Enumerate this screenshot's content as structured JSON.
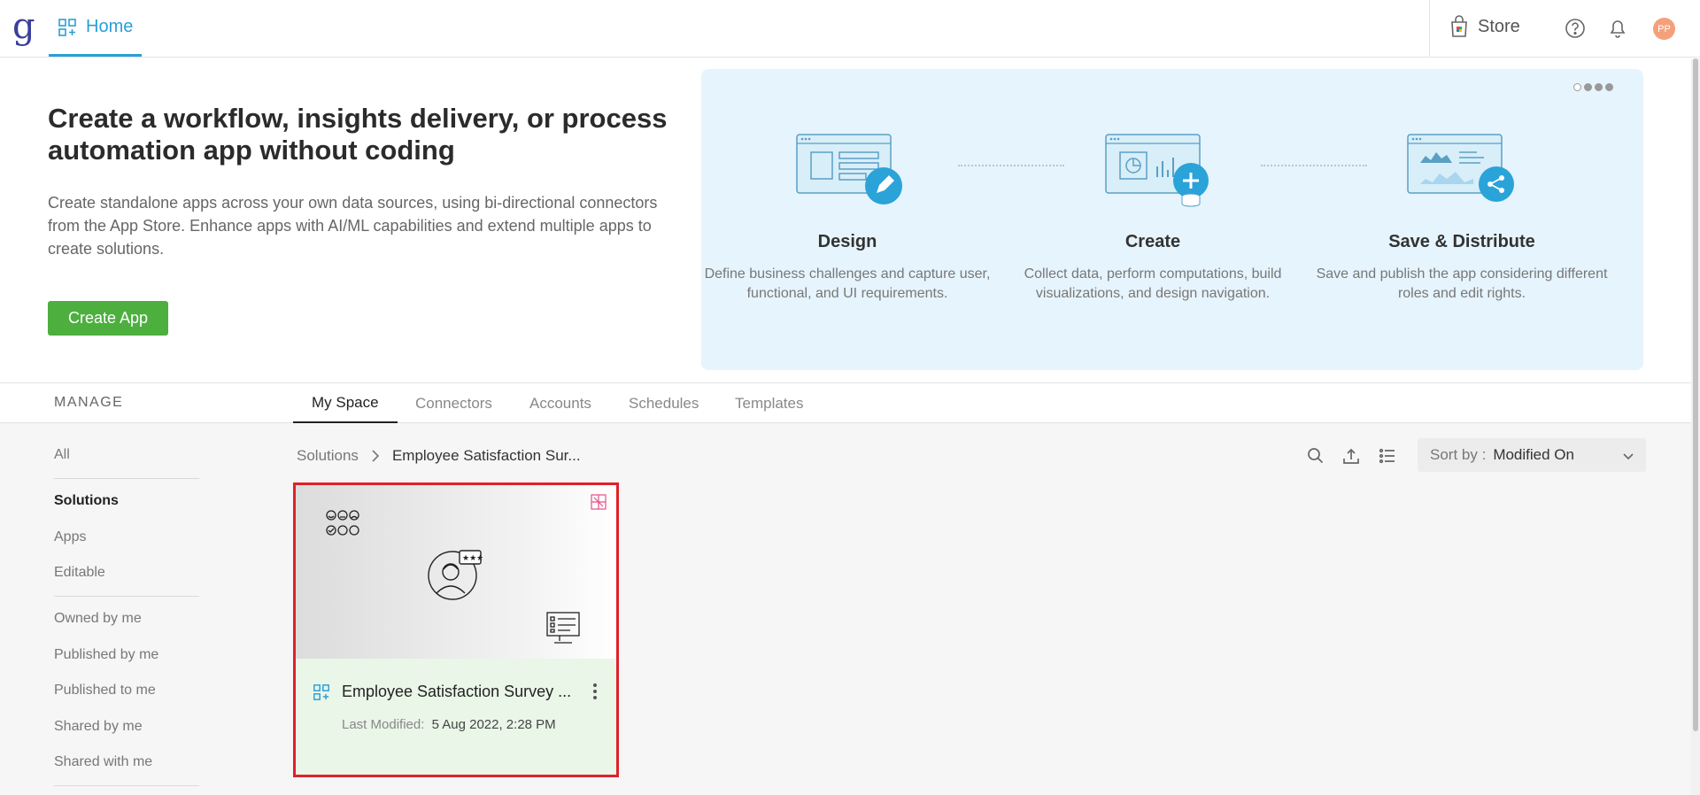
{
  "topbar": {
    "logo": "g",
    "home_label": "Home",
    "store_label": "Store",
    "avatar_initials": "PP"
  },
  "hero": {
    "title": "Create a workflow, insights delivery, or process automation app without coding",
    "description": "Create standalone apps across your own data sources, using bi-directional connectors from the App Store. Enhance apps with AI/ML capabilities and extend multiple apps to create solutions.",
    "create_button": "Create App"
  },
  "promo": {
    "steps": [
      {
        "title": "Design",
        "description": "Define business challenges and capture user, functional, and UI requirements."
      },
      {
        "title": "Create",
        "description": "Collect data, perform computations, build visualizations, and design navigation."
      },
      {
        "title": "Save & Distribute",
        "description": "Save and publish the app considering different roles and edit rights."
      }
    ],
    "accent_color": "#2aa3d9"
  },
  "manage": {
    "label": "MANAGE",
    "tabs": [
      {
        "label": "My Space"
      },
      {
        "label": "Connectors"
      },
      {
        "label": "Accounts"
      },
      {
        "label": "Schedules"
      },
      {
        "label": "Templates"
      }
    ]
  },
  "sidebar": {
    "items": [
      {
        "label": "All"
      },
      {
        "label": "Solutions"
      },
      {
        "label": "Apps"
      },
      {
        "label": "Editable"
      },
      {
        "label": "Owned by me"
      },
      {
        "label": "Published by me"
      },
      {
        "label": "Published to me"
      },
      {
        "label": "Shared by me"
      },
      {
        "label": "Shared with me"
      }
    ]
  },
  "breadcrumb": {
    "root": "Solutions",
    "current": "Employee Satisfaction Sur..."
  },
  "sort": {
    "label": "Sort by :",
    "value": "Modified On"
  },
  "card": {
    "title": "Employee Satisfaction Survey ...",
    "modified_label": "Last Modified:",
    "modified_value": "5 Aug 2022, 2:28 PM"
  }
}
